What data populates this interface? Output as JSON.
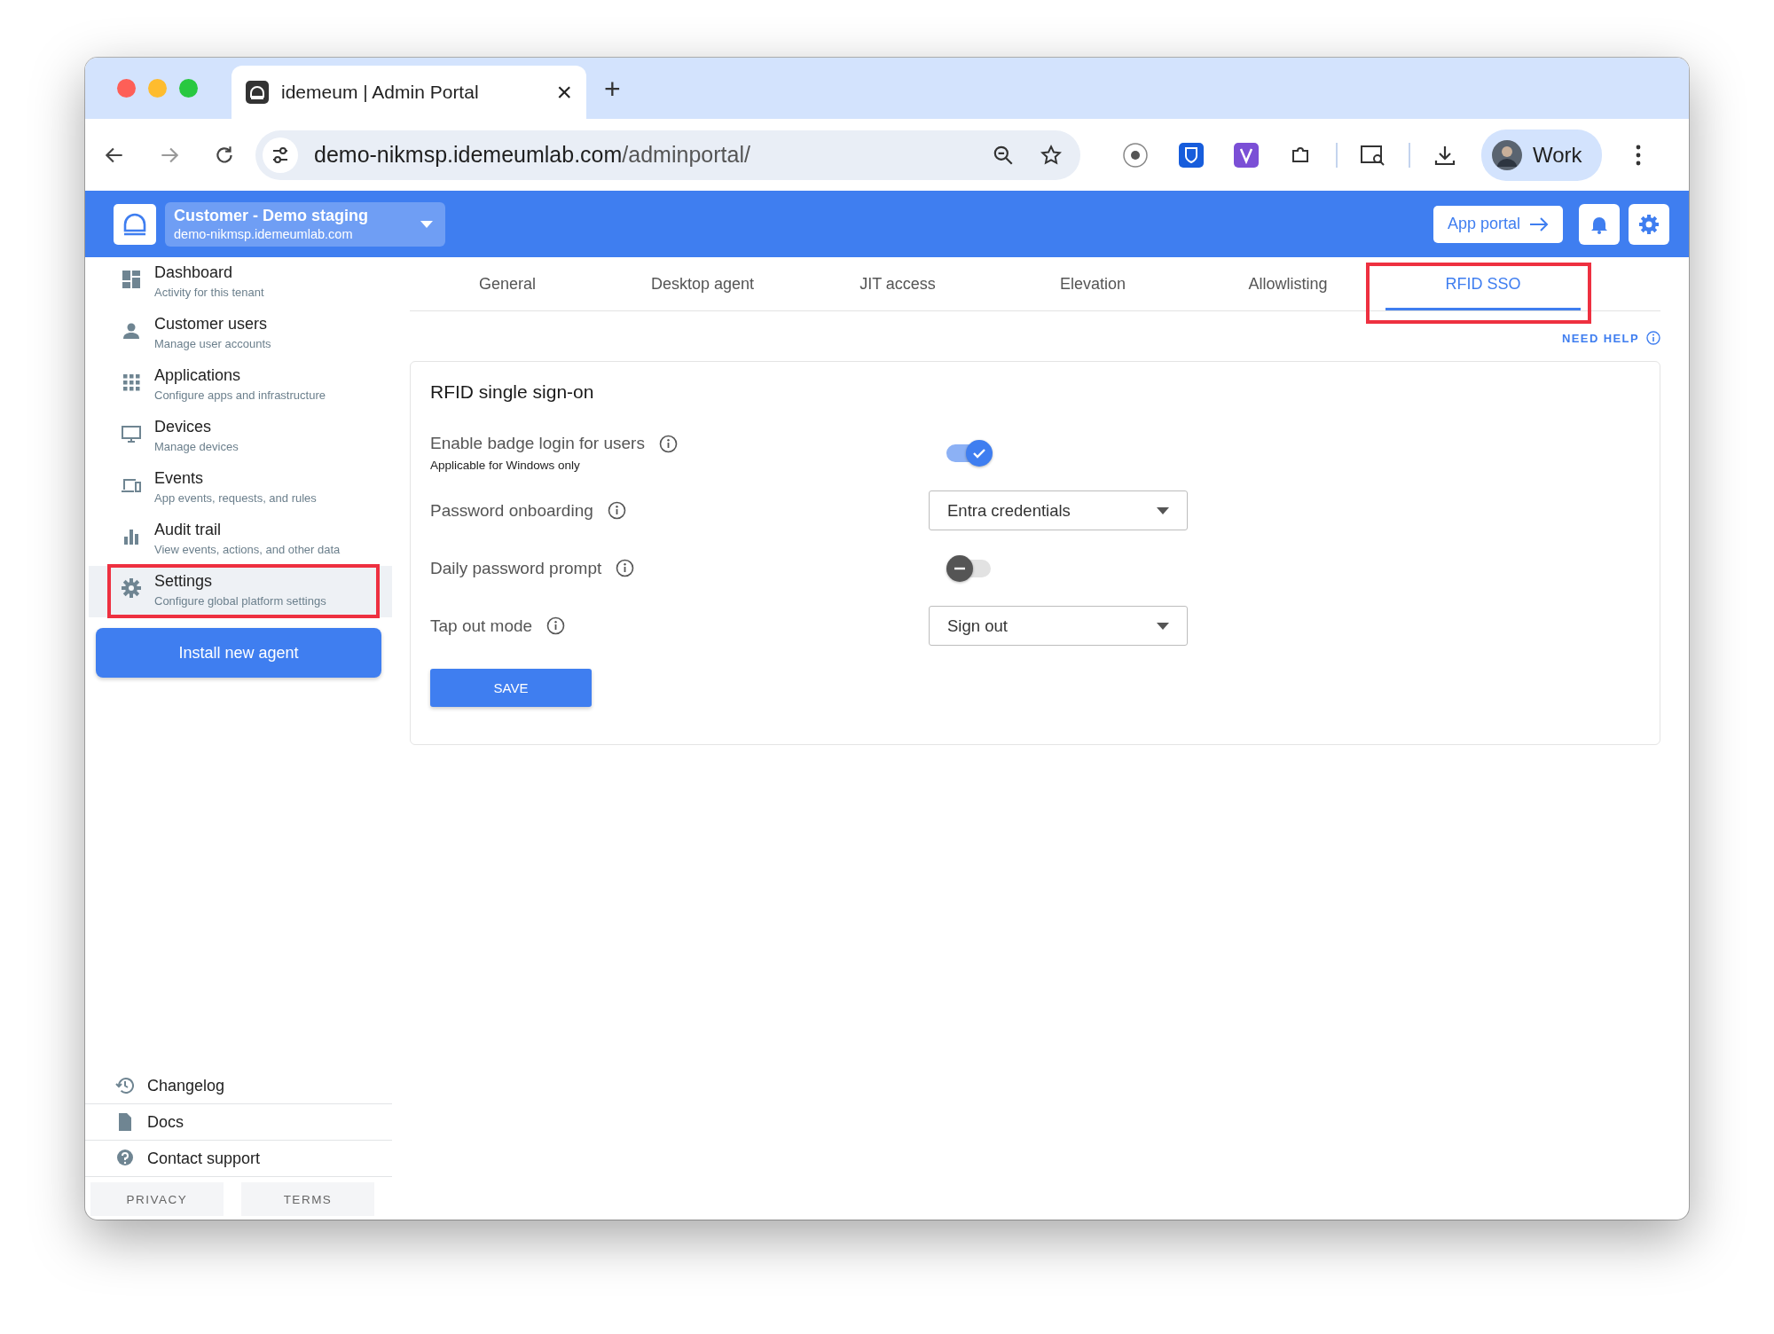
{
  "browser": {
    "tab_title": "idemeum | Admin Portal",
    "close_glyph": "×",
    "new_tab_glyph": "+",
    "url_host": "demo-nikmsp.idemeumlab.com",
    "url_path": "/adminportal/",
    "profile": "Work"
  },
  "header": {
    "tenant_name": "Customer - Demo staging",
    "tenant_domain": "demo-nikmsp.idemeumlab.com",
    "app_portal": "App portal"
  },
  "sidebar": {
    "items": [
      {
        "title": "Dashboard",
        "subtitle": "Activity for this tenant",
        "selected": false,
        "highlighted": false
      },
      {
        "title": "Customer users",
        "subtitle": "Manage user accounts",
        "selected": false,
        "highlighted": false
      },
      {
        "title": "Applications",
        "subtitle": "Configure apps and infrastructure",
        "selected": false,
        "highlighted": false
      },
      {
        "title": "Devices",
        "subtitle": "Manage devices",
        "selected": false,
        "highlighted": false
      },
      {
        "title": "Events",
        "subtitle": "App events, requests, and rules",
        "selected": false,
        "highlighted": false
      },
      {
        "title": "Audit trail",
        "subtitle": "View events, actions, and other data",
        "selected": false,
        "highlighted": false
      },
      {
        "title": "Settings",
        "subtitle": "Configure global platform settings",
        "selected": true,
        "highlighted": true
      }
    ],
    "install_button": "Install new agent",
    "links": [
      "Changelog",
      "Docs",
      "Contact support"
    ],
    "footer_buttons": [
      "PRIVACY",
      "TERMS"
    ]
  },
  "tabs": [
    {
      "label": "General",
      "selected": false,
      "highlighted": false
    },
    {
      "label": "Desktop agent",
      "selected": false,
      "highlighted": false
    },
    {
      "label": "JIT access",
      "selected": false,
      "highlighted": false
    },
    {
      "label": "Elevation",
      "selected": false,
      "highlighted": false
    },
    {
      "label": "Allowlisting",
      "selected": false,
      "highlighted": false
    },
    {
      "label": "RFID SSO",
      "selected": true,
      "highlighted": true
    }
  ],
  "need_help": "NEED HELP",
  "card": {
    "title": "RFID single sign-on",
    "rows": [
      {
        "kind": "toggle",
        "label": "Enable badge login for users",
        "note": "Applicable for Windows only",
        "on": true
      },
      {
        "kind": "select",
        "label": "Password onboarding",
        "value": "Entra credentials"
      },
      {
        "kind": "toggle",
        "label": "Daily password prompt",
        "on": false
      },
      {
        "kind": "select",
        "label": "Tap out mode",
        "value": "Sign out"
      }
    ],
    "save": "SAVE"
  }
}
